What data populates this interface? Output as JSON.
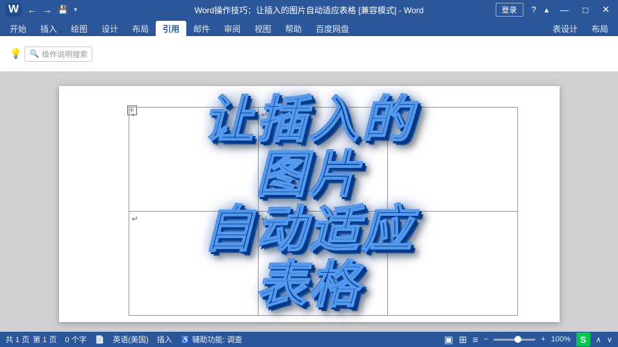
{
  "titlebar": {
    "title": "Word操作技巧：让插入的图片自动适应表格 [兼容模式] - Word",
    "app_name": "Word",
    "quick_access": [
      "←",
      "→",
      "💾"
    ],
    "login_label": "登录",
    "win_minimize": "—",
    "win_maximize": "□",
    "win_close": "✕"
  },
  "ribbon": {
    "tabs_left": [
      "开始",
      "插入",
      "绘图",
      "设计",
      "布局",
      "引用",
      "邮件",
      "审阅",
      "视图",
      "帮助",
      "百度网盘"
    ],
    "tabs_right": [
      "表设计",
      "布局"
    ],
    "active_tab": "引用",
    "toolbar_groups": [
      {
        "items": [
          "表设计",
          "布局"
        ]
      }
    ],
    "search_placeholder": "操作说明搜索",
    "lightbulb": "💡"
  },
  "document": {
    "table": {
      "rows": 2,
      "cols": 3,
      "cells": [
        [
          "↵",
          "↵",
          "↵"
        ],
        [
          "↵",
          "↵",
          "↵"
        ]
      ]
    },
    "title_text": "让插入的\n图片\n自动适应\n表格"
  },
  "statusbar": {
    "pages": "共 1 页",
    "page_num": "1",
    "words": "0 个字",
    "lang": "英语(美国)",
    "insert_mode": "插入",
    "macro": "📄",
    "accessibility": "♿ 辅助功能: 调查",
    "view_mode_print": "▣",
    "view_mode_web": "⊞",
    "view_mode_read": "≡",
    "zoom_percent": "−",
    "zoom_value": "100%",
    "zoom_plus": "+",
    "zoom_level": "100%",
    "right_icons": "五 ∨ ∧"
  },
  "colors": {
    "accent": "#2b579a",
    "text_blue": "#1a6fd4",
    "text_blue_dark": "#003a8c"
  }
}
